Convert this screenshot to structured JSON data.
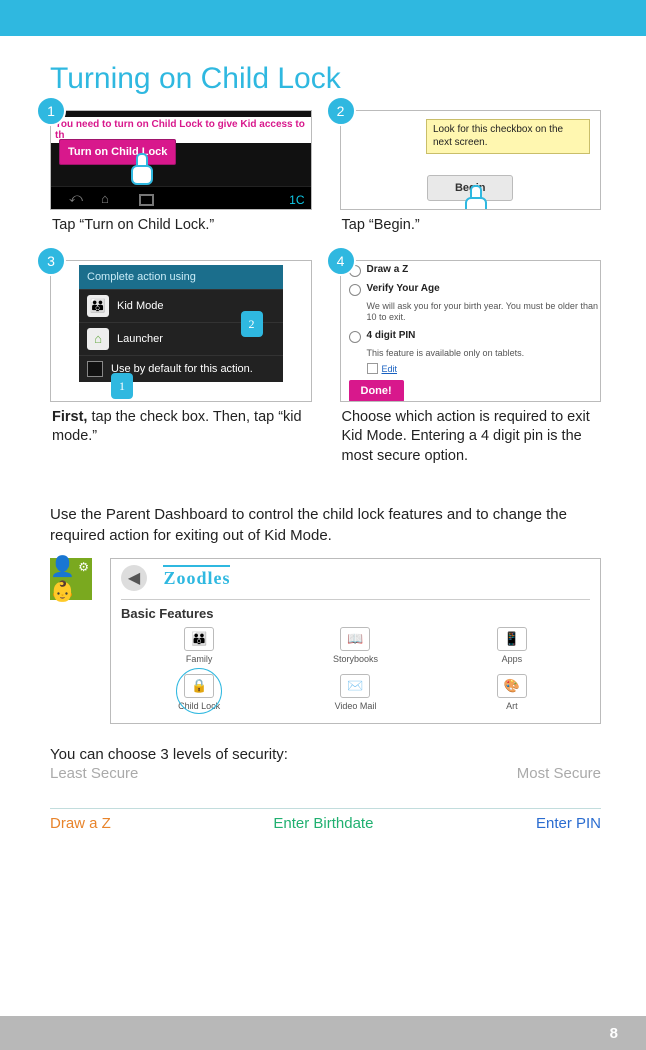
{
  "title": "Turning on Child Lock",
  "steps": [
    {
      "badge": "1",
      "caption_html": "Tap “Turn on Child Lock.”",
      "thumb": {
        "message": "You need to turn on Child Lock to give Kid access to th",
        "button": "Turn on Child Lock",
        "clock": "1C"
      }
    },
    {
      "badge": "2",
      "caption_html": "Tap “Begin.”",
      "thumb": {
        "tip": "Look for this checkbox on the next screen.",
        "button": "Begin"
      }
    },
    {
      "badge": "3",
      "caption_first": "First,",
      "caption_rest": " tap the check box. Then, tap “kid mode.”",
      "thumb": {
        "header": "Complete action using",
        "row1": "Kid Mode",
        "row2": "Launcher",
        "row3": "Use by default for this action.",
        "pointer1": "1",
        "pointer2": "2"
      }
    },
    {
      "badge": "4",
      "caption_html": "Choose which action is required to exit Kid Mode. Entering a 4 digit pin is the most secure option.",
      "thumb": {
        "opt1": "Draw a Z",
        "opt2": "Verify Your Age",
        "opt2_sub": "We will ask you for your birth year. You must be older than 10 to exit.",
        "opt3": "4 digit PIN",
        "opt3_sub": "This feature is available only on tablets.",
        "edit": "Edit",
        "done": "Done!"
      }
    }
  ],
  "dashboard_intro": "Use the Parent Dashboard to control the child lock features and to change the required action for exiting out of Kid Mode.",
  "dashboard": {
    "brand": "Zoodles",
    "section": "Basic Features",
    "features": [
      "Family",
      "Storybooks",
      "Apps",
      "Child Lock",
      "Video Mail",
      "Art"
    ],
    "feature_icons": [
      "👪",
      "📖",
      "📱",
      "🔒",
      "✉️",
      "🎨"
    ]
  },
  "security": {
    "intro": "You can choose 3 levels of security:",
    "least": "Least Secure",
    "most": "Most Secure",
    "methods": [
      "Draw a Z",
      "Enter Birthdate",
      "Enter PIN"
    ]
  },
  "page_number": "8"
}
